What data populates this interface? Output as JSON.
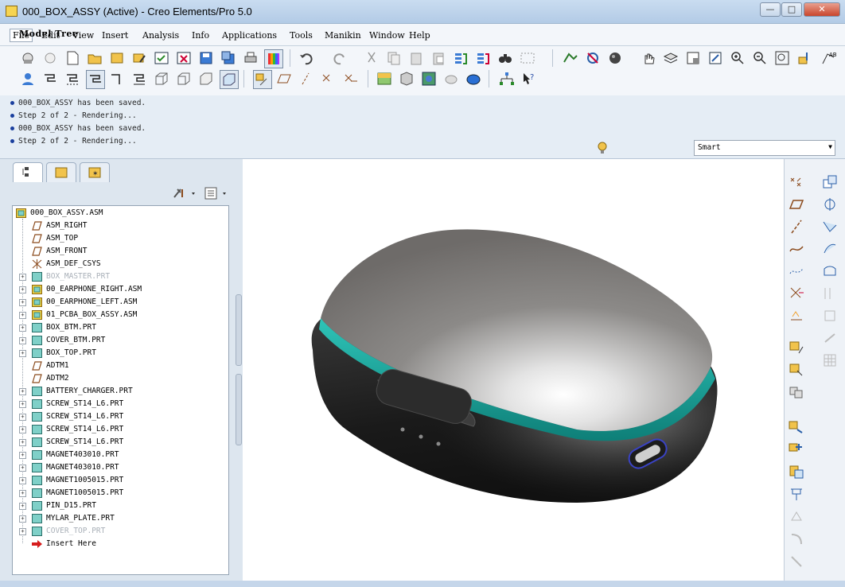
{
  "window": {
    "title": "000_BOX_ASSY (Active) - Creo Elements/Pro 5.0",
    "minimize": "—",
    "maximize": "□",
    "close": "✕"
  },
  "menu": [
    "File",
    "Edit",
    "View",
    "Insert",
    "Analysis",
    "Info",
    "Applications",
    "Tools",
    "Manikin",
    "Window",
    "Help"
  ],
  "messages": [
    "000_BOX_ASSY has been saved.",
    "Step 2 of 2 - Rendering...",
    "000_BOX_ASSY has been saved.",
    "Step 2 of 2 - Rendering..."
  ],
  "filter": {
    "selected": "Smart"
  },
  "tree_panel": {
    "title": "Model Tree"
  },
  "tree": [
    {
      "label": "000_BOX_ASSY.ASM",
      "icon": "assembly-icon",
      "expander": false,
      "dim": false,
      "root": true
    },
    {
      "label": "ASM_RIGHT",
      "icon": "datum-plane-icon",
      "expander": false,
      "dim": false
    },
    {
      "label": "ASM_TOP",
      "icon": "datum-plane-icon",
      "expander": false,
      "dim": false
    },
    {
      "label": "ASM_FRONT",
      "icon": "datum-plane-icon",
      "expander": false,
      "dim": false
    },
    {
      "label": "ASM_DEF_CSYS",
      "icon": "csys-icon",
      "expander": false,
      "dim": false
    },
    {
      "label": "BOX_MASTER.PRT",
      "icon": "part-icon",
      "expander": true,
      "dim": true
    },
    {
      "label": "00_EARPHONE_RIGHT.ASM",
      "icon": "assembly-icon",
      "expander": true,
      "dim": false
    },
    {
      "label": "00_EARPHONE_LEFT.ASM",
      "icon": "assembly-icon",
      "expander": true,
      "dim": false
    },
    {
      "label": "01_PCBA_BOX_ASSY.ASM",
      "icon": "assembly-icon",
      "expander": true,
      "dim": false
    },
    {
      "label": "BOX_BTM.PRT",
      "icon": "part-icon",
      "expander": true,
      "dim": false
    },
    {
      "label": "COVER_BTM.PRT",
      "icon": "part-icon",
      "expander": true,
      "dim": false
    },
    {
      "label": "BOX_TOP.PRT",
      "icon": "part-icon",
      "expander": true,
      "dim": false
    },
    {
      "label": "ADTM1",
      "icon": "datum-plane-icon",
      "expander": false,
      "dim": false
    },
    {
      "label": "ADTM2",
      "icon": "datum-plane-icon",
      "expander": false,
      "dim": false
    },
    {
      "label": "BATTERY_CHARGER.PRT",
      "icon": "part-icon",
      "expander": true,
      "dim": false
    },
    {
      "label": "SCREW_ST14_L6.PRT",
      "icon": "part-icon",
      "expander": true,
      "dim": false
    },
    {
      "label": "SCREW_ST14_L6.PRT",
      "icon": "part-icon",
      "expander": true,
      "dim": false
    },
    {
      "label": "SCREW_ST14_L6.PRT",
      "icon": "part-icon",
      "expander": true,
      "dim": false
    },
    {
      "label": "SCREW_ST14_L6.PRT",
      "icon": "part-icon",
      "expander": true,
      "dim": false
    },
    {
      "label": "MAGNET403010.PRT",
      "icon": "part-icon",
      "expander": true,
      "dim": false
    },
    {
      "label": "MAGNET403010.PRT",
      "icon": "part-icon",
      "expander": true,
      "dim": false
    },
    {
      "label": "MAGNET1005015.PRT",
      "icon": "part-icon",
      "expander": true,
      "dim": false
    },
    {
      "label": "MAGNET1005015.PRT",
      "icon": "part-icon",
      "expander": true,
      "dim": false
    },
    {
      "label": "PIN_D15.PRT",
      "icon": "part-icon",
      "expander": true,
      "dim": false
    },
    {
      "label": "MYLAR_PLATE.PRT",
      "icon": "part-icon",
      "expander": true,
      "dim": false
    },
    {
      "label": "COVER_TOP.PRT",
      "icon": "part-icon",
      "expander": true,
      "dim": true
    },
    {
      "label": "Insert Here",
      "icon": "insert-here-icon",
      "expander": false,
      "dim": false
    }
  ],
  "colors": {
    "accent_band": "#1aa39a",
    "assembly_icon": "#f4d03f",
    "part_icon": "#7fd0c8",
    "datum_icon": "#8b4a1c"
  }
}
